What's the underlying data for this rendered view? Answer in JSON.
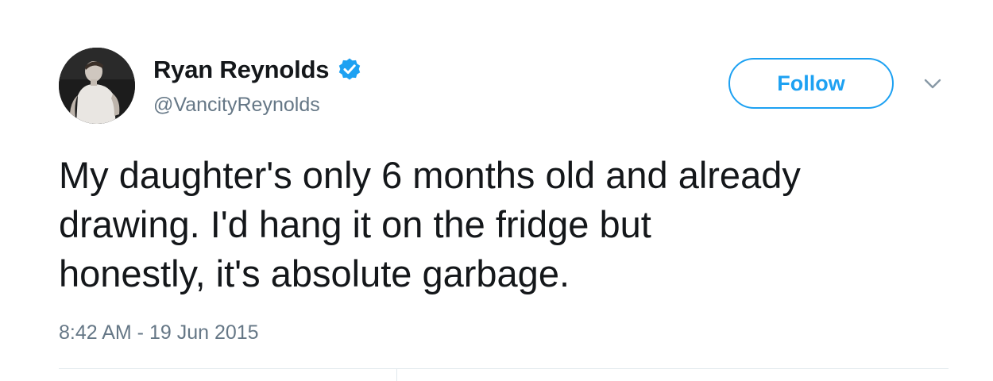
{
  "user": {
    "display_name": "Ryan Reynolds",
    "handle": "@VancityReynolds",
    "verified": true,
    "avatar_icon": "profile-photo"
  },
  "actions": {
    "follow_label": "Follow",
    "more_icon": "chevron-down-icon"
  },
  "tweet": {
    "text_lines": [
      "My daughter's only 6 months old and already",
      "drawing. I'd hang it on the fridge but",
      "honestly, it's absolute garbage."
    ],
    "timestamp": "8:42 AM - 19 Jun 2015"
  },
  "colors": {
    "accent": "#1da1f2",
    "text_primary": "#14171a",
    "text_secondary": "#657786",
    "divider": "#e1e8ed"
  }
}
